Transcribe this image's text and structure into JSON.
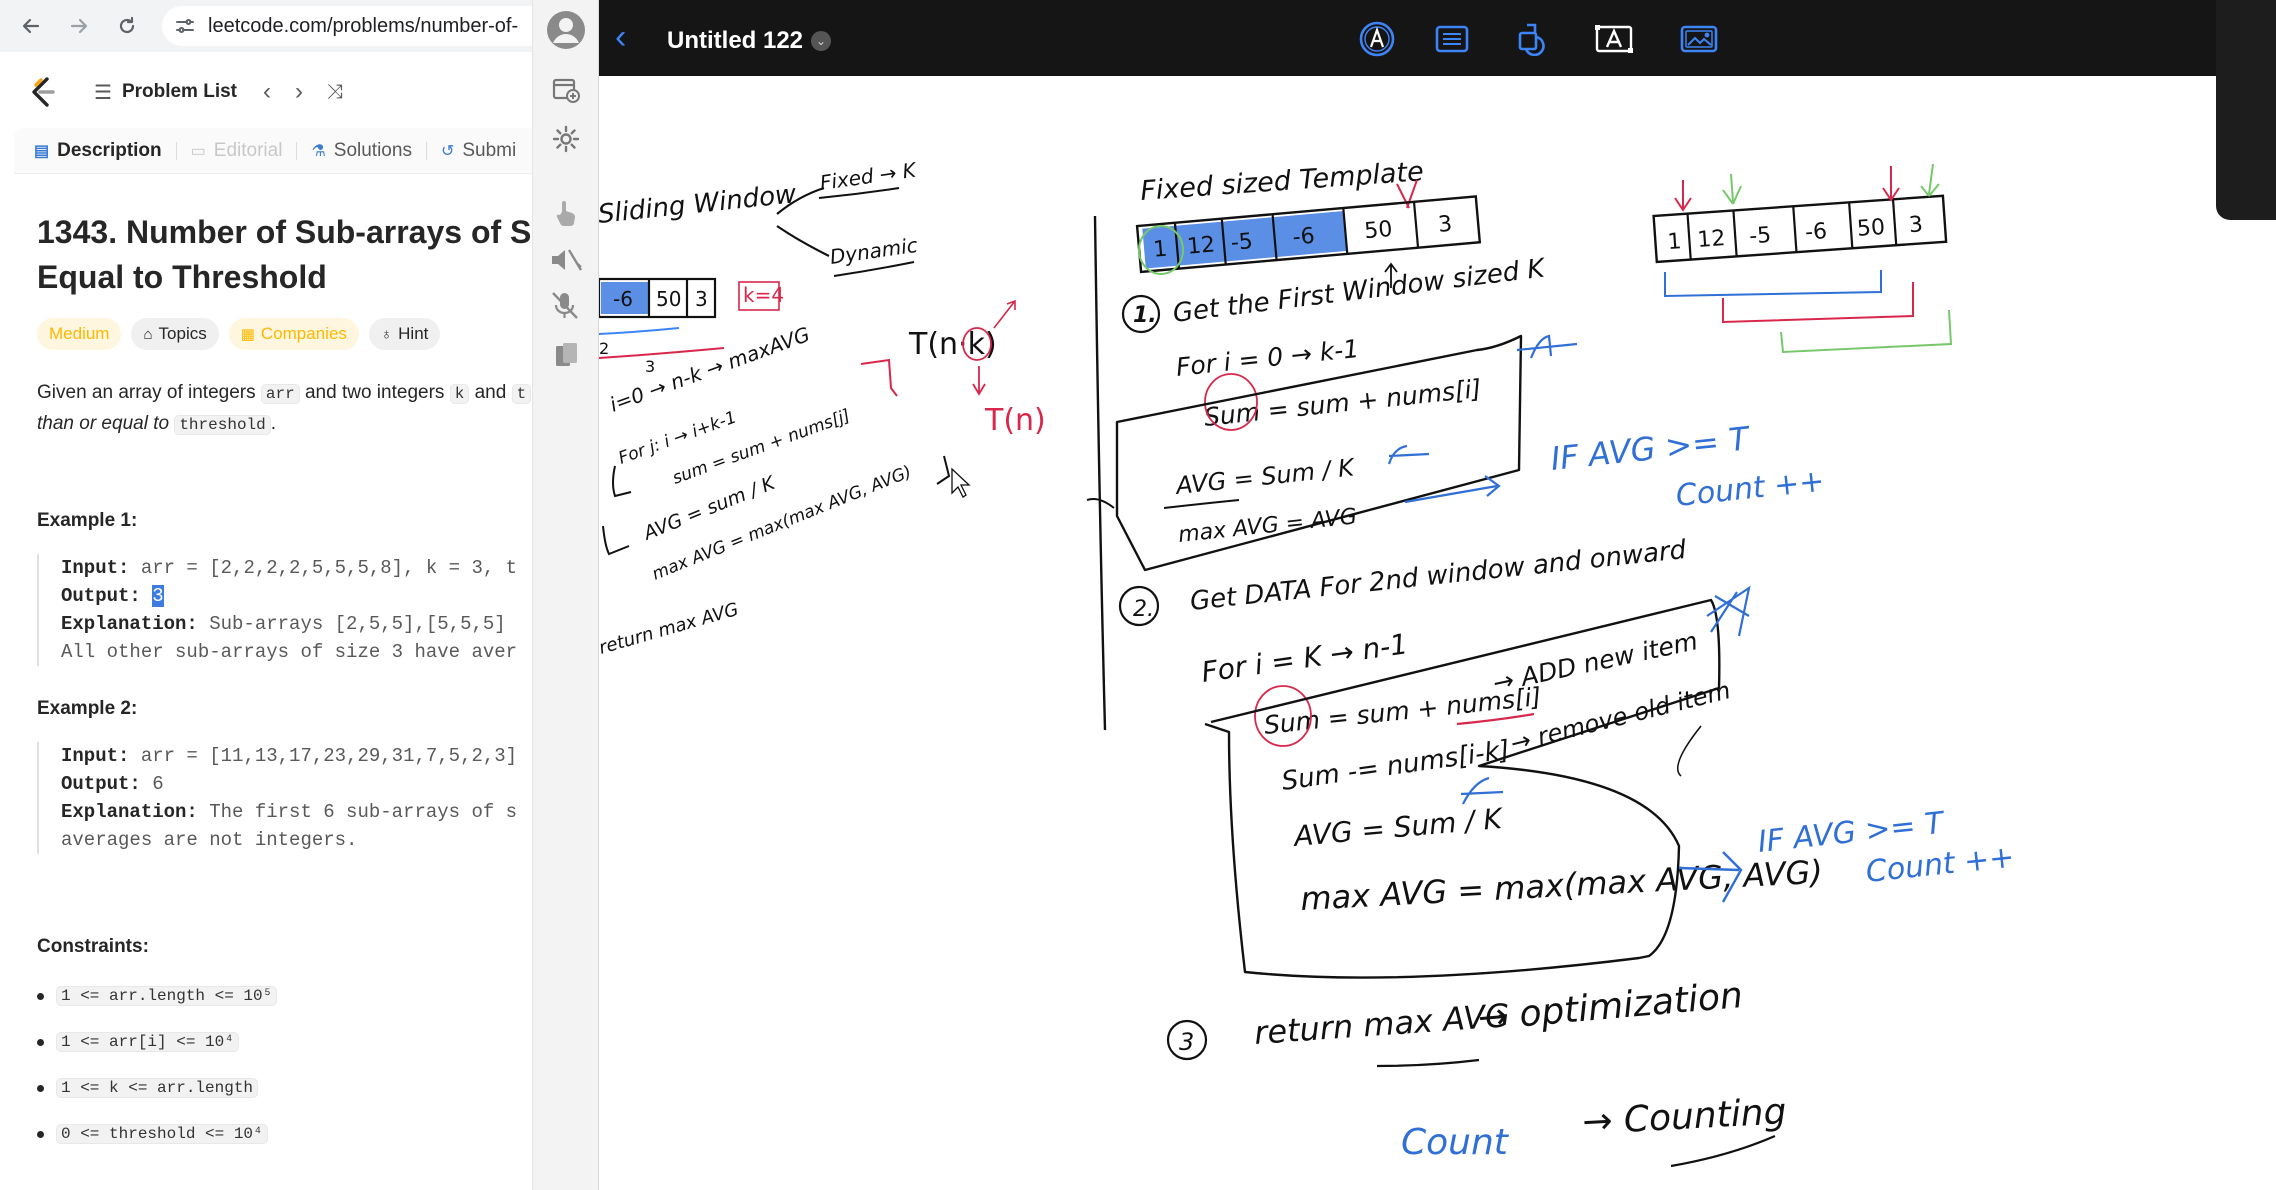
{
  "browser": {
    "url": "leetcode.com/problems/number-of-"
  },
  "leetcode": {
    "problem_list_label": "Problem List",
    "tabs": [
      {
        "label": "Description"
      },
      {
        "label": "Editorial"
      },
      {
        "label": "Solutions"
      },
      {
        "label": "Submi"
      }
    ],
    "title_line1": "1343. Number of Sub-arrays of S",
    "title_line2": "Equal to Threshold",
    "chips": [
      {
        "label": "Medium"
      },
      {
        "label": "Topics"
      },
      {
        "label": "Companies"
      },
      {
        "label": "Hint"
      }
    ],
    "desc": {
      "t1": "Given an array of integers ",
      "c1": "arr",
      "t2": " and two integers ",
      "c2": "k",
      "t3": " and ",
      "c3": "t",
      "t4": "than or equal to ",
      "c4": "threshold",
      "t5": "."
    },
    "example1": {
      "heading": "Example 1:",
      "input_label": "Input:",
      "input_value": " arr = [2,2,2,2,5,5,5,8], k = 3, t",
      "output_label": "Output:",
      "output_value": "3",
      "explanation_label": "Explanation:",
      "explanation_value": " Sub-arrays [2,5,5],[5,5,5]",
      "line4": "All other sub-arrays of size 3 have aver"
    },
    "example2": {
      "heading": "Example 2:",
      "input_label": "Input:",
      "input_value": " arr = [11,13,17,23,29,31,7,5,2,3]",
      "output_label": "Output:",
      "output_value": " 6",
      "explanation_label": "Explanation:",
      "explanation_value": " The first 6 sub-arrays of s",
      "line4": "averages are not integers."
    },
    "constraints": {
      "heading": "Constraints:",
      "items": [
        "1 <= arr.length <= 10⁵",
        "1 <= arr[i] <= 10⁴",
        "1 <= k <= arr.length",
        "0 <= threshold <= 10⁴"
      ]
    }
  },
  "notes_app": {
    "doc_title": "Untitled 122",
    "tools": [
      "pen-tool-icon",
      "lined-paper-icon",
      "shapes-icon",
      "text-box-icon",
      "image-icon"
    ]
  },
  "colors": {
    "header_bg": "#151515",
    "accent_blue": "#3d84f7",
    "ink_black": "#111111",
    "ink_red": "#d9274b",
    "ink_blue": "#2f6fd6",
    "ink_green": "#77c86a",
    "difficulty_medium": "#ffb800"
  },
  "handwriting": {
    "sliding_window": "Sliding Window",
    "fixed_k": "Fixed → K",
    "dynamic": "Dynamic",
    "small_array": [
      "-6",
      "50",
      "3"
    ],
    "k_eq": "k=4",
    "two": "2",
    "three": "3",
    "loop_i": "i=0 → n-k → maxAVG",
    "loop_j": "For j: i → i+k-1",
    "sum_line": "sum = sum + nums[j]",
    "avg_line": "AVG = sum / K",
    "max_line": "max AVG = max(max AVG, AVG)",
    "return_line": "return max AVG",
    "t_nk": "T(n·k)",
    "t_n": "T(n)",
    "template_title": "Fixed sized Template",
    "array_main": [
      "1",
      "12",
      "-5",
      "-6",
      "50",
      "3"
    ],
    "step1": "Get the First Window sized K",
    "for1": "For i = 0 → k-1",
    "sum1": "Sum = sum + nums[i]",
    "avg1": "AVG = Sum / K",
    "maxavg1": "max AVG = AVG",
    "if1a": "IF AVG >= T",
    "if1b": "Count ++",
    "step2": "Get DATA For 2nd window and onward",
    "for2": "For i = K → n-1",
    "sum2": "Sum = sum + nums[i]",
    "add_new": "→ ADD new item",
    "sub2": "Sum -= nums[i-k]",
    "remove_old": "→ remove old item",
    "avg2": "AVG = Sum / K",
    "max2": "max AVG = max(max AVG, AVG)",
    "if2a": "IF AVG >= T",
    "if2b": "Count ++",
    "step3": "return max AVG",
    "optimization": "→ optimization",
    "count": "Count",
    "counting": "→ Counting",
    "array_right": [
      "1",
      "12",
      "-5",
      "-6",
      "50",
      "3"
    ],
    "step_nums": [
      "1.",
      "2.",
      "3"
    ]
  }
}
